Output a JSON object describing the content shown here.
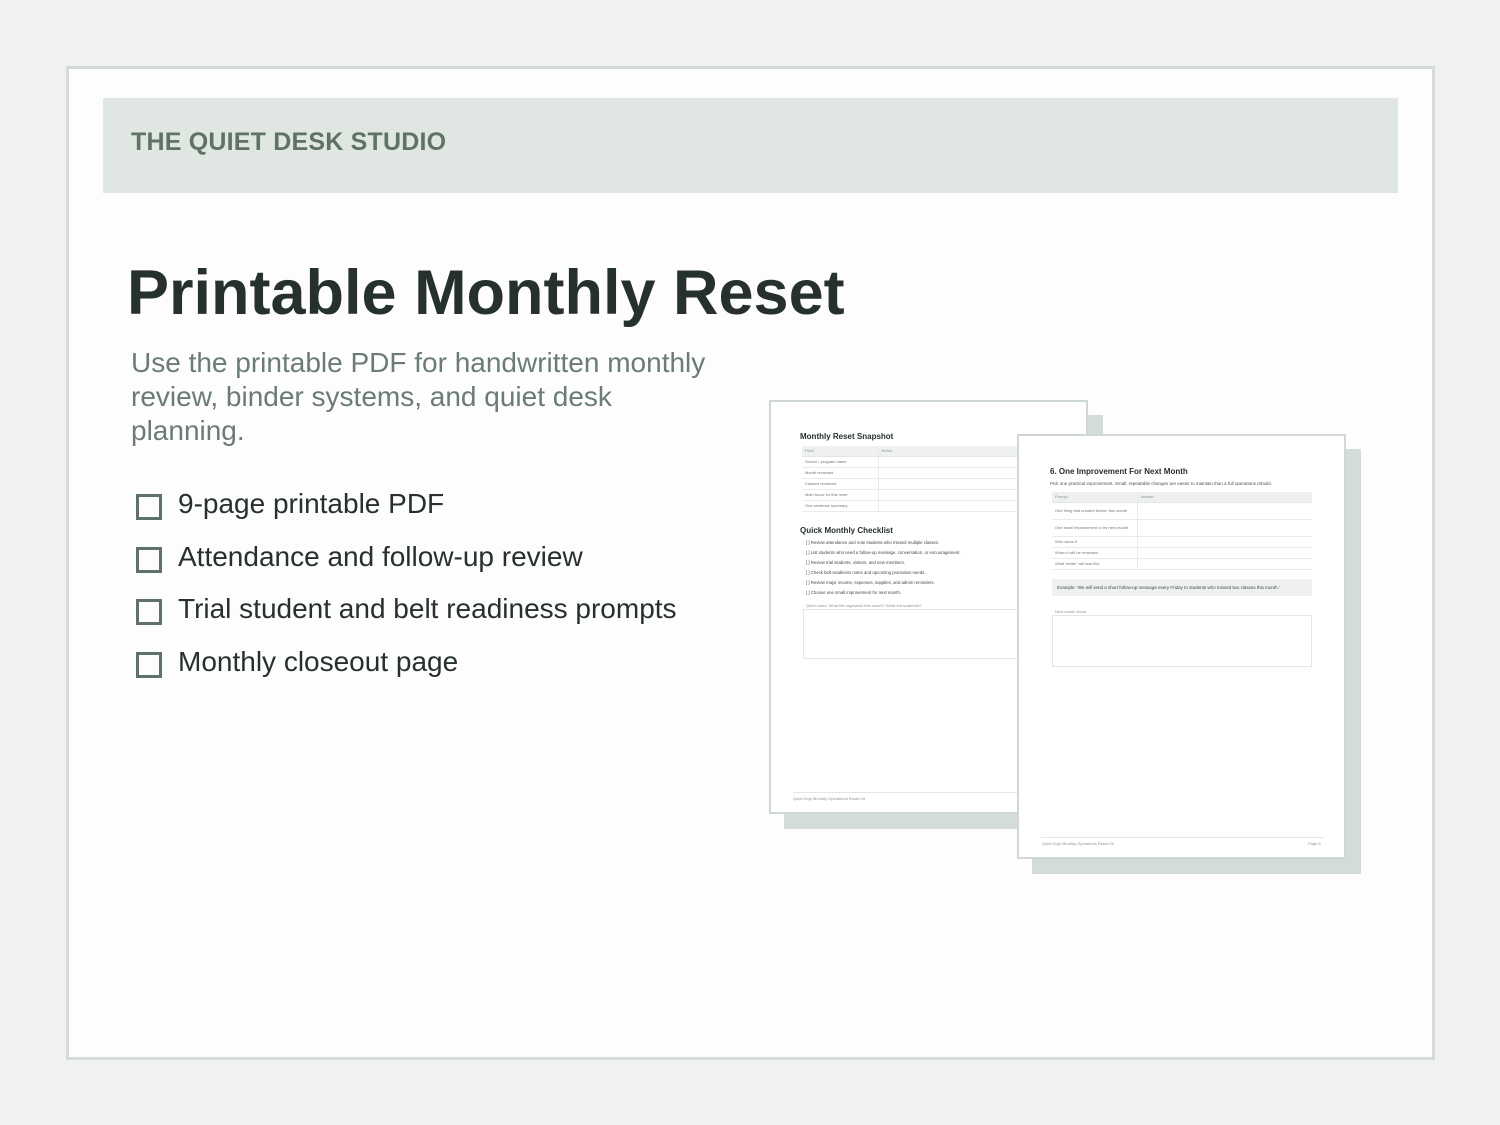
{
  "brand": "THE QUIET DESK STUDIO",
  "headline": "Printable Monthly Reset",
  "subtitle": "Use the printable PDF for handwritten monthly review, binder systems, and quiet desk planning.",
  "features": [
    "9-page printable PDF",
    "Attendance and follow-up review",
    "Trial student and belt readiness prompts",
    "Monthly closeout page"
  ],
  "page_back": {
    "title": "Monthly Reset Snapshot",
    "table_headers": [
      "Field",
      "Notes"
    ],
    "table_rows": [
      "School / program name",
      "Month reviewed",
      "Classes reviewed",
      "Main focus for this reset",
      "One sentence summary"
    ],
    "checklist_title": "Quick Monthly Checklist",
    "checklist": [
      "[ ] Review attendance and note students who missed multiple classes.",
      "[ ] List students who need a follow-up message, conversation, or encouragement.",
      "[ ] Review trial students, visitors, and new members.",
      "[ ] Check belt-readiness notes and upcoming promotion needs.",
      "[ ] Review major income, expenses, supplies, and admin reminders.",
      "[ ] Choose one small improvement for next month."
    ],
    "notes_label": "Quiet notes: What felt organized this month? What felt scattered?",
    "footer": "Quiet Dojo Monthly Operations Reset Kit"
  },
  "page_front": {
    "title": "6. One Improvement For Next Month",
    "intro": "Pick one practical improvement. Small, repeatable changes are easier to maintain than a full operations rebuild.",
    "table_headers": [
      "Prompt",
      "Answer"
    ],
    "table_rows": [
      "One thing that created friction this month",
      "One small improvement to try next month",
      "Who owns it",
      "When it will be reviewed",
      "What 'better' will look like"
    ],
    "example": "Example: 'We will send a short follow-up message every Friday to students who missed two classes this month.'",
    "focus_label": "Next month focus",
    "footer_left": "Quiet Dojo Monthly Operations Reset Kit",
    "footer_right": "Page 8"
  }
}
